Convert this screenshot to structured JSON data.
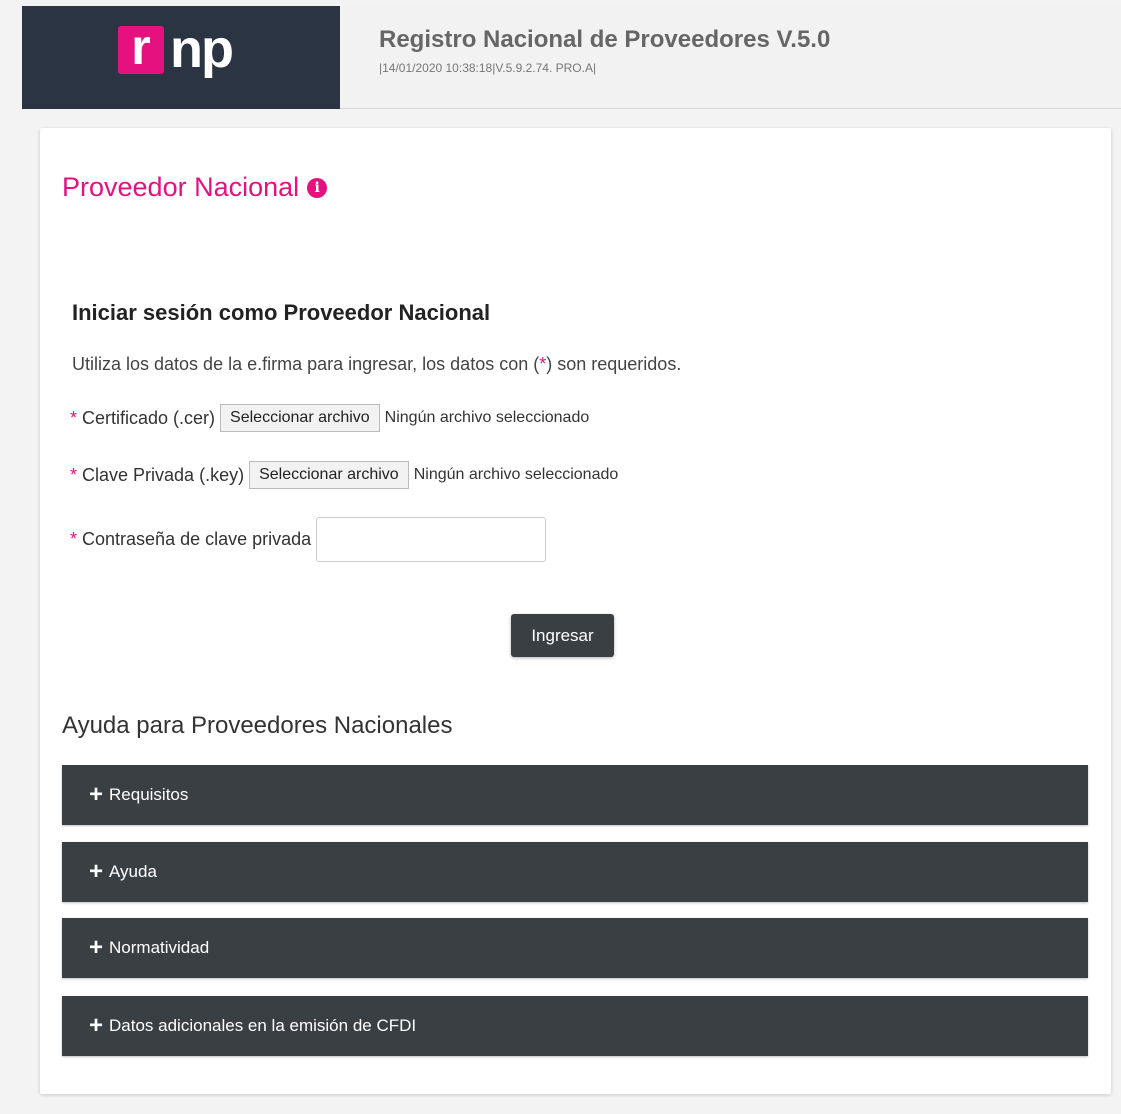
{
  "header": {
    "logo_r": "r",
    "logo_rest": "np",
    "title": "Registro Nacional de Proveedores V.5.0",
    "build": "|14/01/2020 10:38:18|V.5.9.2.74. PRO.A|"
  },
  "page": {
    "title": "Proveedor Nacional",
    "info_icon": "i"
  },
  "login": {
    "heading": "Iniciar sesión como Proveedor Nacional",
    "desc_before": "Utiliza los datos de la e.firma para ingresar, los datos con (",
    "desc_star": "*",
    "desc_after": ") son requeridos.",
    "required_mark": "*",
    "cert_label": "Certificado (.cer)",
    "key_label": "Clave Privada (.key)",
    "file_button": "Seleccionar archivo",
    "no_file": "Ningún archivo seleccionado",
    "password_label": "Contraseña de clave privada",
    "password_value": "",
    "submit": "Ingresar"
  },
  "help": {
    "heading": "Ayuda para Proveedores Nacionales",
    "expand_icon": "+",
    "items": [
      {
        "label": "Requisitos"
      },
      {
        "label": "Ayuda"
      },
      {
        "label": "Normatividad"
      },
      {
        "label": "Datos adicionales en la emisión de CFDI"
      }
    ]
  },
  "colors": {
    "brand": "#e5117f",
    "header_dark": "#2b3442",
    "accordion": "#3a3f44"
  }
}
